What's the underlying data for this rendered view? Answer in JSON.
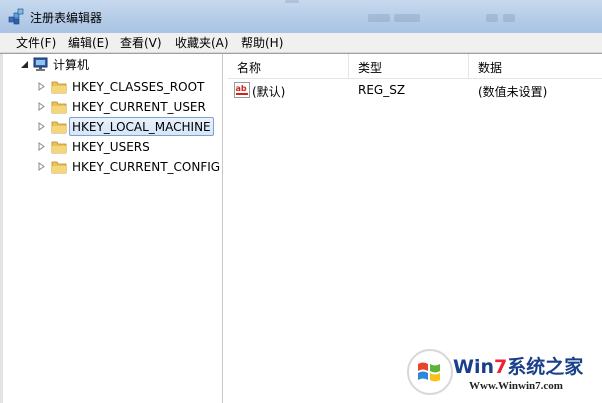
{
  "window": {
    "title": "注册表编辑器"
  },
  "menu": {
    "file": "文件(F)",
    "edit": "编辑(E)",
    "view": "查看(V)",
    "favorites": "收藏夹(A)",
    "help": "帮助(H)"
  },
  "tree": {
    "root": "计算机",
    "items": [
      {
        "label": "HKEY_CLASSES_ROOT"
      },
      {
        "label": "HKEY_CURRENT_USER"
      },
      {
        "label": "HKEY_LOCAL_MACHINE",
        "selected": true
      },
      {
        "label": "HKEY_USERS"
      },
      {
        "label": "HKEY_CURRENT_CONFIG"
      }
    ]
  },
  "list": {
    "columns": {
      "name": "名称",
      "type": "类型",
      "data": "数据"
    },
    "rows": [
      {
        "name": "(默认)",
        "type": "REG_SZ",
        "data": "(数值未设置)"
      }
    ]
  },
  "watermark": {
    "title_prefix": "Win",
    "title_seven": "7",
    "title_suffix": "系统之家",
    "url": "Www.Winwin7.com"
  },
  "colors": {
    "titlebar": "#b9cfe9",
    "menubar": "#f0f0f0",
    "selection_border": "#7da2ce",
    "folder": "#e8c25a"
  },
  "icons": {
    "app": "regedit-icon",
    "computer": "computer-icon",
    "folder": "folder-icon",
    "string_value": "string-value-icon"
  }
}
